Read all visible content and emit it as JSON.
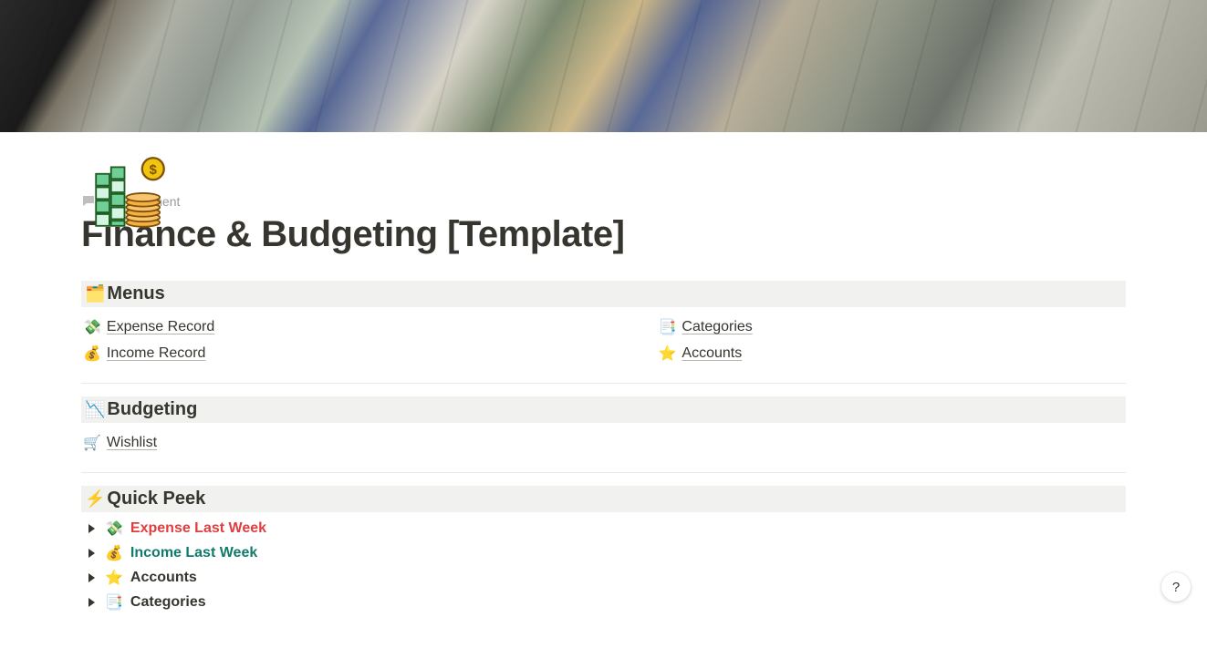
{
  "add_comment_label": "Add comment",
  "page_title": "Finance & Budgeting [Template]",
  "sections": {
    "menus": {
      "icon": "🗂️",
      "label": "Menus"
    },
    "budgeting": {
      "icon": "📉",
      "label": "Budgeting"
    },
    "quickpeek": {
      "icon": "⚡",
      "label": "Quick Peek"
    }
  },
  "menus_items": [
    {
      "icon": "💸",
      "label": "Expense Record"
    },
    {
      "icon": "📑",
      "label": "Categories"
    },
    {
      "icon": "💰",
      "label": "Income Record"
    },
    {
      "icon": "⭐",
      "label": "Accounts"
    }
  ],
  "budgeting_items": [
    {
      "icon": "🛒",
      "label": "Wishlist"
    }
  ],
  "quickpeek_items": [
    {
      "icon": "💸",
      "label": "Expense Last Week",
      "color": "red"
    },
    {
      "icon": "💰",
      "label": "Income Last Week",
      "color": "teal"
    },
    {
      "icon": "⭐",
      "label": "Accounts",
      "color": "default"
    },
    {
      "icon": "📑",
      "label": "Categories",
      "color": "default"
    }
  ],
  "help_label": "?"
}
